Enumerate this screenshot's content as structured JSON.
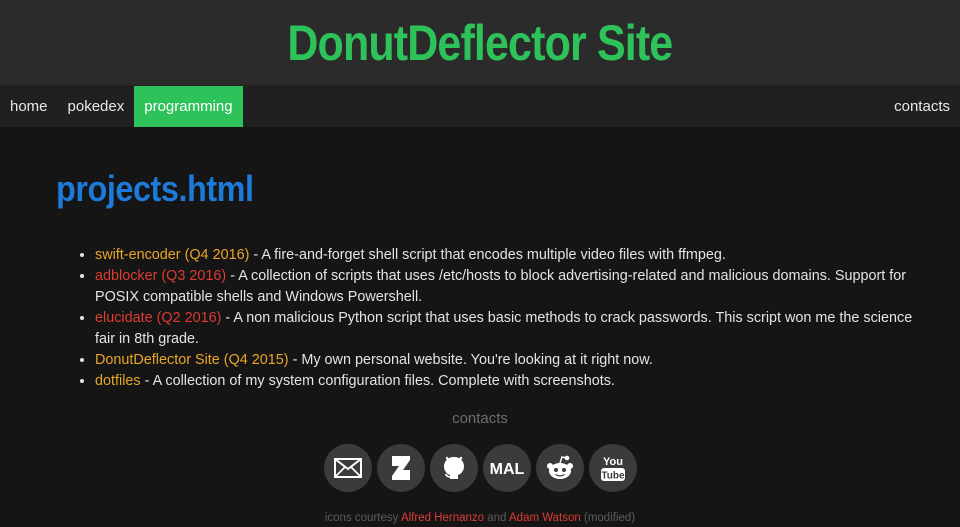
{
  "header": {
    "title": "DonutDeflector Site"
  },
  "nav": {
    "left": [
      {
        "label": "home",
        "active": false
      },
      {
        "label": "pokedex",
        "active": false
      },
      {
        "label": "programming",
        "active": true
      }
    ],
    "right": [
      {
        "label": "contacts",
        "active": false
      }
    ],
    "active_color": "#2ec35a"
  },
  "main": {
    "heading": "projects.html",
    "projects": [
      {
        "link": "swift-encoder (Q4 2016)",
        "link_color": "#e8a629",
        "desc": " - A fire-and-forget shell script that encodes multiple video files with ffmpeg."
      },
      {
        "link": "adblocker (Q3 2016)",
        "link_color": "#dd3b32",
        "desc": " - A collection of scripts that uses /etc/hosts to block advertising-related and malicious domains. Support for POSIX compatible shells and Windows Powershell."
      },
      {
        "link": "elucidate (Q2 2016)",
        "link_color": "#dd3b32",
        "desc": " - A non malicious Python script that uses basic methods to crack passwords. This script won me the science fair in 8th grade."
      },
      {
        "link": "DonutDeflector Site (Q4 2015)",
        "link_color": "#e8a629",
        "desc": " - My own personal website. You're looking at it right now."
      },
      {
        "link": "dotfiles",
        "link_color": "#e8a629",
        "desc": " - A collection of my system configuration files. Complete with screenshots."
      }
    ]
  },
  "contacts": {
    "heading": "contacts",
    "icons": [
      "email-icon",
      "deviantart-icon",
      "github-icon",
      "myanimelist-icon",
      "reddit-icon",
      "youtube-icon"
    ],
    "mal_label": "MAL",
    "youtube_top": "You",
    "youtube_bottom": "Tube"
  },
  "credits": {
    "prefix": "icons courtesy ",
    "author1": "Alfred Hernanzo",
    "middle": " and ",
    "author2": "Adam Watson",
    "suffix": " (modified)"
  },
  "colors": {
    "title": "#2ec35a",
    "heading": "#1e7ad8",
    "link_orange": "#e8a629",
    "link_red": "#dd3b32",
    "background": "#151515"
  }
}
